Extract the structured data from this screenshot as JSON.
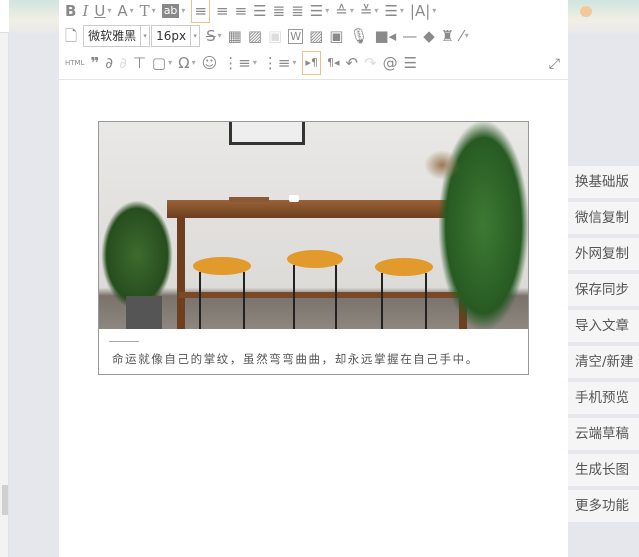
{
  "toolbar": {
    "font_family": "微软雅黑",
    "font_size": "16px",
    "html_label": "HTML",
    "row1": [
      "bold-icon",
      "italic-icon",
      "underline-icon",
      "font-color-icon",
      "format-icon",
      "background-color-icon",
      "align-left-icon",
      "align-center-icon",
      "align-right-icon",
      "align-justify-icon",
      "indent-icon",
      "line-height-icon",
      "row-spacing-top-icon",
      "row-spacing-bottom-icon",
      "list-indent-icon",
      "letter-spacing-icon"
    ],
    "row2": [
      "new-document-icon",
      "strikethrough-icon",
      "table-icon",
      "image-icon",
      "word-image-icon",
      "word-icon",
      "insert-image-icon",
      "multi-image-icon",
      "audio-icon",
      "video-icon",
      "horizontal-rule-icon",
      "eraser-icon",
      "format-painter-icon",
      "magic-wand-icon"
    ],
    "row3": [
      "quote-icon",
      "link-icon",
      "unlink-icon",
      "template-icon",
      "frame-icon",
      "special-char-icon",
      "emoji-icon",
      "ordered-list-icon",
      "unordered-list-icon",
      "ltr-icon",
      "rtl-icon",
      "undo-icon",
      "redo-icon",
      "search-replace-icon",
      "paragraph-format-icon",
      "fullscreen-icon"
    ]
  },
  "content": {
    "caption": "命运就像自己的掌纹，虽然弯弯曲曲，却永远掌握在自己手中。"
  },
  "sidebar": [
    "换基础版",
    "微信复制",
    "外网复制",
    "保存同步",
    "导入文章",
    "清空/新建",
    "手机预览",
    "云端草稿",
    "生成长图",
    "更多功能"
  ]
}
